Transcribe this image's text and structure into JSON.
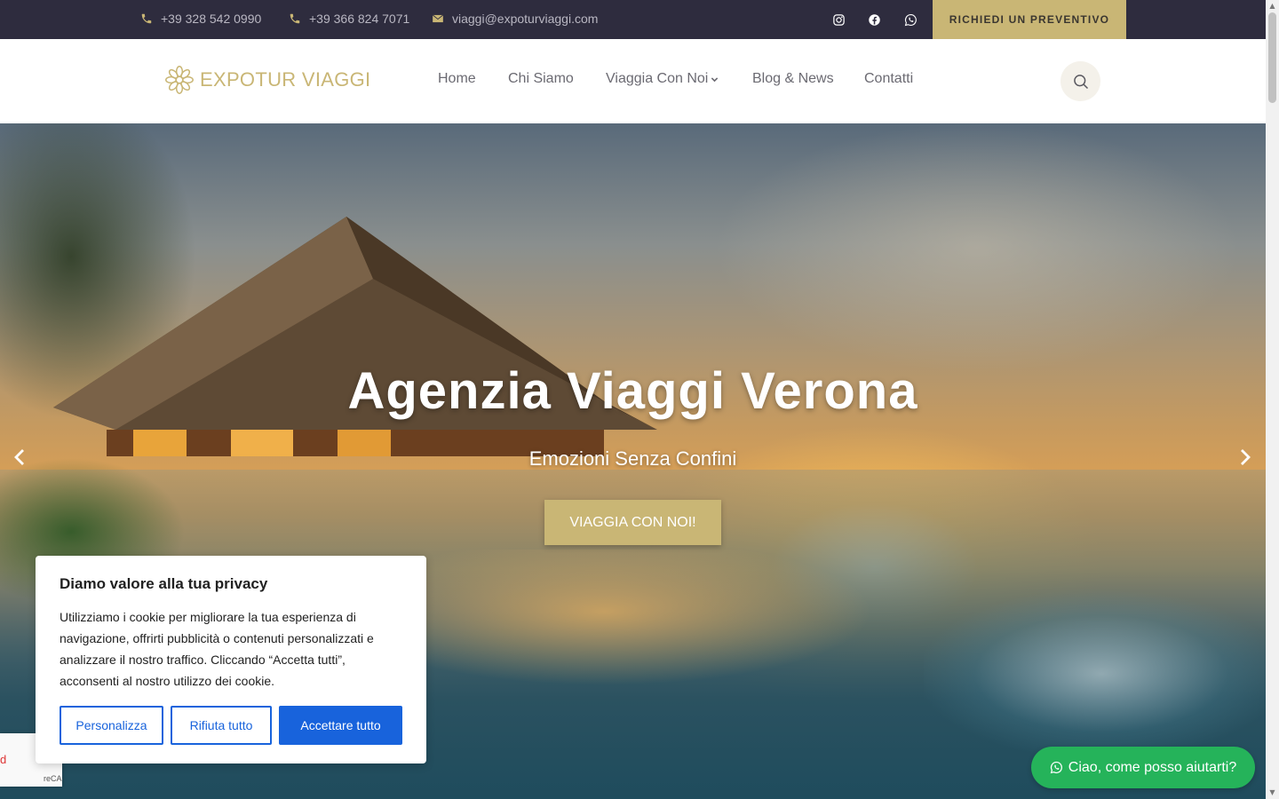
{
  "topbar": {
    "phone1": "+39 328 542 0990",
    "phone2": "+39 366 824 7071",
    "email": "viaggi@expoturviaggi.com",
    "quote_button": "RICHIEDI UN PREVENTIVO",
    "social_icons": [
      "instagram-icon",
      "facebook-icon",
      "whatsapp-icon"
    ]
  },
  "header": {
    "logo_text": "EXPOTUR VIAGGI",
    "nav": [
      "Home",
      "Chi Siamo",
      "Viaggia Con Noi",
      "Blog & News",
      "Contatti"
    ]
  },
  "hero": {
    "title": "Agenzia Viaggi Verona",
    "subtitle": "Emozioni Senza Confini",
    "button": "VIAGGIA CON NOI!"
  },
  "cookie": {
    "title": "Diamo valore alla tua privacy",
    "text": "Utilizziamo i cookie per migliorare la tua esperienza di navigazione, offrirti pubblicità o contenuti personalizzati e analizzare il nostro traffico. Cliccando “Accetta tutti”, acconsenti al nostro utilizzo dei cookie.",
    "btn_customize": "Personalizza",
    "btn_reject": "Rifiuta tutto",
    "btn_accept": "Accettare tutto"
  },
  "recaptcha": {
    "label": "reCA",
    "mark": "d"
  },
  "whatsapp": {
    "label": "Ciao, come posso aiutarti?"
  },
  "colors": {
    "gold": "#c9b675",
    "topbar": "#2e2c3e",
    "cookie_blue": "#1863dc",
    "whatsapp_green": "#25b35a"
  }
}
